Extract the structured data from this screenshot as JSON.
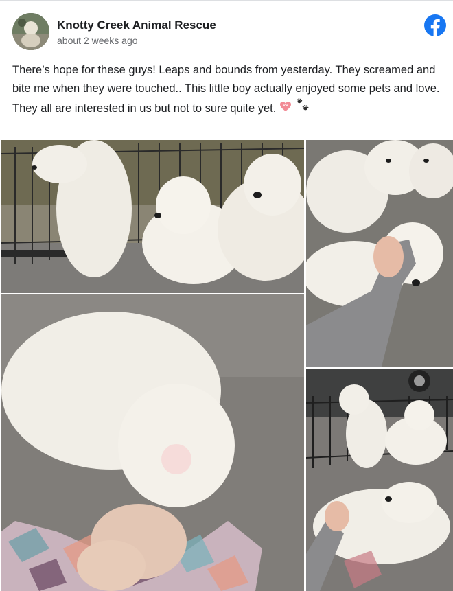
{
  "post": {
    "page_name": "Knotty Creek Animal Rescue",
    "timestamp": "about 2 weeks ago",
    "text": "There’s hope for these guys! Leaps and bounds from yesterday. They screamed and bite me when they were touched.. This little boy actually enjoyed some pets and love. They all are interested in us but not to sure quite yet.",
    "emojis": [
      "heart-icon",
      "paw-prints-icon"
    ]
  },
  "icons": {
    "brand": "facebook-icon",
    "brand_color": "#1877f2"
  },
  "photos": [
    {
      "name": "photo-puppies-by-fence"
    },
    {
      "name": "photo-puppy-on-blanket"
    },
    {
      "name": "photo-petting-puppy"
    },
    {
      "name": "photo-puppies-group-and-belly-rub"
    }
  ]
}
